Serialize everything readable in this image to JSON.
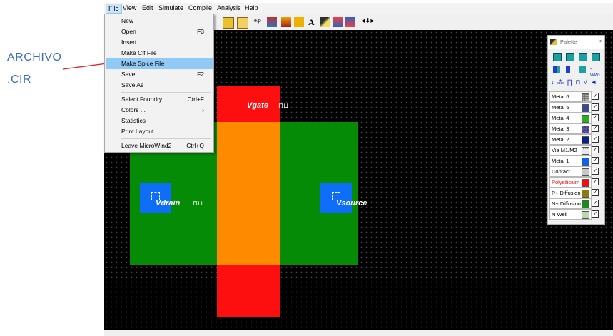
{
  "annotation": {
    "line1": "ARCHIVO",
    "line2": ".CIR",
    "arrow_color": "#e02020",
    "text_color": "#3a6fb5"
  },
  "menubar": [
    "File",
    "View",
    "Edit",
    "Simulate",
    "Compile",
    "Analysis",
    "Help"
  ],
  "file_menu": {
    "items": [
      {
        "label": "New",
        "shortcut": ""
      },
      {
        "label": "Open",
        "shortcut": "F3"
      },
      {
        "label": "Insert",
        "shortcut": ""
      },
      {
        "label": "Make Cif File",
        "shortcut": ""
      },
      {
        "label": "Make Spice File",
        "shortcut": "",
        "highlighted": true
      },
      {
        "label": "Save",
        "shortcut": "F2"
      },
      {
        "label": "Save As",
        "shortcut": ""
      },
      {
        "label": "Select Foundry",
        "shortcut": "Ctrl+F"
      },
      {
        "label": "Colors ...",
        "shortcut": "›"
      },
      {
        "label": "Statistics",
        "shortcut": ""
      },
      {
        "label": "Print Layout",
        "shortcut": ""
      },
      {
        "label": "Leave MicroWind2",
        "shortcut": "Ctrl+Q"
      }
    ]
  },
  "toolbar": {
    "text_tool_glyph": "A",
    "icons": [
      "connection-icon",
      "layout-icon",
      "measure-icon",
      "mos-generator-icon",
      "compile-icon",
      "text-icon",
      "pen-icon",
      "graph-icon",
      "simulate-icon",
      "move-arrows-icon"
    ]
  },
  "layout": {
    "labels": {
      "gate": "Vgate",
      "drain": "Vdrain",
      "source": "Vsource"
    },
    "wave_glyph": "⊓⊔",
    "colors": {
      "diffusion": "#058b05",
      "poly": "#fe0f0f",
      "gate_overlap": "#fe8a00",
      "metal1": "#0f6ef7",
      "background": "#000000"
    }
  },
  "palette": {
    "title": "Palette",
    "close": "×",
    "symbols": "↕ ⁂ ∏ ⊓ √ ◄",
    "layers": [
      {
        "name": "Metal 6",
        "color": "#b0b0b0",
        "checked": true
      },
      {
        "name": "Metal 5",
        "color": "#3c4a94",
        "checked": true
      },
      {
        "name": "Metal 4",
        "color": "#2cae1e",
        "checked": true
      },
      {
        "name": "Metal 3",
        "color": "#5a5aa8",
        "checked": true
      },
      {
        "name": "Metal 2",
        "color": "#0a1f8c",
        "checked": true
      },
      {
        "name": "Via M1/M2",
        "color": "#e8e8e8",
        "checked": true
      },
      {
        "name": "Metal 1",
        "color": "#1060f0",
        "checked": true
      },
      {
        "name": "Contact",
        "color": "#c8c8c8",
        "checked": true
      },
      {
        "name": "Polysilicium",
        "color": "#f20f0f",
        "checked": true,
        "text_color": "#e01010"
      },
      {
        "name": "P+ Diffusion",
        "color": "#8b7a10",
        "checked": true
      },
      {
        "name": "N+ Diffusion",
        "color": "#1b8b1b",
        "checked": true
      },
      {
        "name": "N Well",
        "color": "#b8d8b0",
        "checked": true
      }
    ]
  }
}
